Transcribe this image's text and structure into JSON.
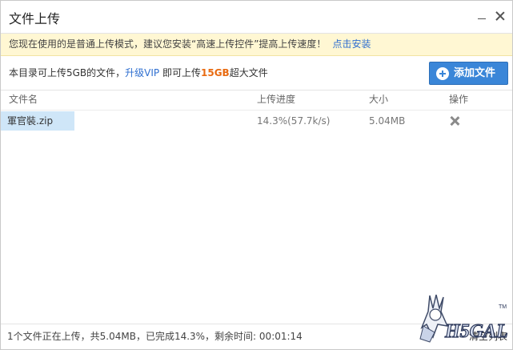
{
  "window": {
    "title": "文件上传",
    "minimize_icon": "minimize-icon",
    "close_icon": "close-icon"
  },
  "notice": {
    "text": "您现在使用的是普通上传模式，建议您安装“高速上传控件”提高上传速度！",
    "link": "点击安装"
  },
  "info": {
    "prefix": "本目录可上传5GB的文件，",
    "vip_link": "升级VIP",
    "middle": " 即可上传",
    "big_size": "15GB",
    "suffix": "超大文件"
  },
  "toolbar": {
    "add_button_label": "添加文件",
    "add_icon": "plus-circle-icon"
  },
  "table": {
    "headers": {
      "name": "文件名",
      "progress": "上传进度",
      "size": "大小",
      "action": "操作"
    },
    "rows": [
      {
        "name": "軍官裝.zip",
        "progress": "14.3%(57.7k/s)",
        "size": "5.04MB",
        "action_icon": "delete-icon"
      }
    ]
  },
  "status": {
    "text": "1个文件正在上传，共5.04MB，已完成14.3%，剩余时间: 00:01:14",
    "list_link": "清空列表"
  },
  "watermark": {
    "text": "H5GAL",
    "tm": "TM"
  },
  "colors": {
    "accent": "#3a86d8",
    "link": "#2f6fd0",
    "highlight": "#e86a10",
    "notice_bg": "#fff7d3",
    "selected_row": "#cfe6f8"
  }
}
